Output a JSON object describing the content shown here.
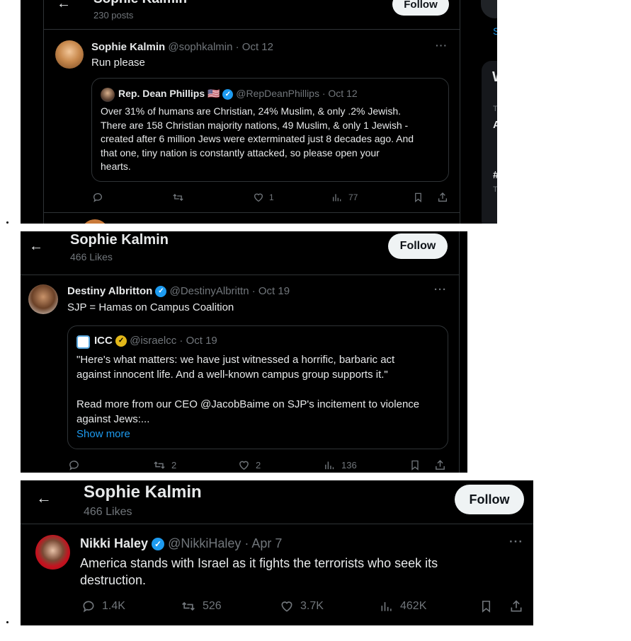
{
  "screenshot1": {
    "header": {
      "name": "Sophie Kalmin",
      "sub": "230 posts",
      "follow": "Follow"
    },
    "tweet": {
      "name": "Sophie Kalmin",
      "handle_date": "@sophkalmin · Oct 12",
      "text": "Run please",
      "quote": {
        "name": "Rep. Dean Phillips",
        "flag": "🇺🇸",
        "handle_date": "@RepDeanPhillips · Oct 12",
        "lines": [
          "Over 31% of humans are Christian, 24% Muslim, & only .2% Jewish.",
          "There are 158 Christian majority nations, 49 Muslim, & only 1 Jewish -",
          "created after 6 million Jews were exterminated just 8 decades ago. And",
          "that one, tiny nation is constantly attacked, so please open your",
          "hearts."
        ]
      },
      "actions": {
        "reply": "",
        "repost": "",
        "like": "1",
        "views": "77"
      }
    },
    "sidebar": {
      "link_letter": "S",
      "card_letter": "W",
      "trend_letters": [
        "T",
        "A",
        "#",
        "T"
      ]
    }
  },
  "screenshot2": {
    "header": {
      "name": "Sophie Kalmin",
      "sub": "466 Likes",
      "follow": "Follow"
    },
    "tweet": {
      "name": "Destiny Albritton",
      "handle_date": "@DestinyAlbrittn · Oct 19",
      "text": "SJP = Hamas on Campus Coalition",
      "quote": {
        "name": "ICC",
        "handle_date": "@israelcc · Oct 19",
        "lines": [
          "\"Here's what matters: we have just witnessed a horrific, barbaric act",
          "against innocent life. And a well-known campus group supports it.\""
        ],
        "lines2": [
          "Read more from our CEO @JacobBaime on SJP's incitement to violence",
          "against Jews:..."
        ],
        "show_more": "Show more"
      },
      "actions": {
        "reply": "",
        "repost": "2",
        "like": "2",
        "views": "136"
      }
    }
  },
  "screenshot3": {
    "header": {
      "name": "Sophie Kalmin",
      "sub": "466 Likes",
      "follow": "Follow"
    },
    "tweet": {
      "name": "Nikki Haley",
      "handle_date": "@NikkiHaley · Apr 7",
      "lines": [
        "America stands with Israel as it fights the terrorists who seek its",
        "destruction."
      ],
      "actions": {
        "reply": "1.4K",
        "repost": "526",
        "like": "3.7K",
        "views": "462K"
      }
    }
  },
  "colors": {
    "background": "#000000",
    "text": "#e7e9ea",
    "muted": "#71767b",
    "accent": "#1d9bf0",
    "border": "#2f3336",
    "follow_bg": "#eff3f4"
  }
}
